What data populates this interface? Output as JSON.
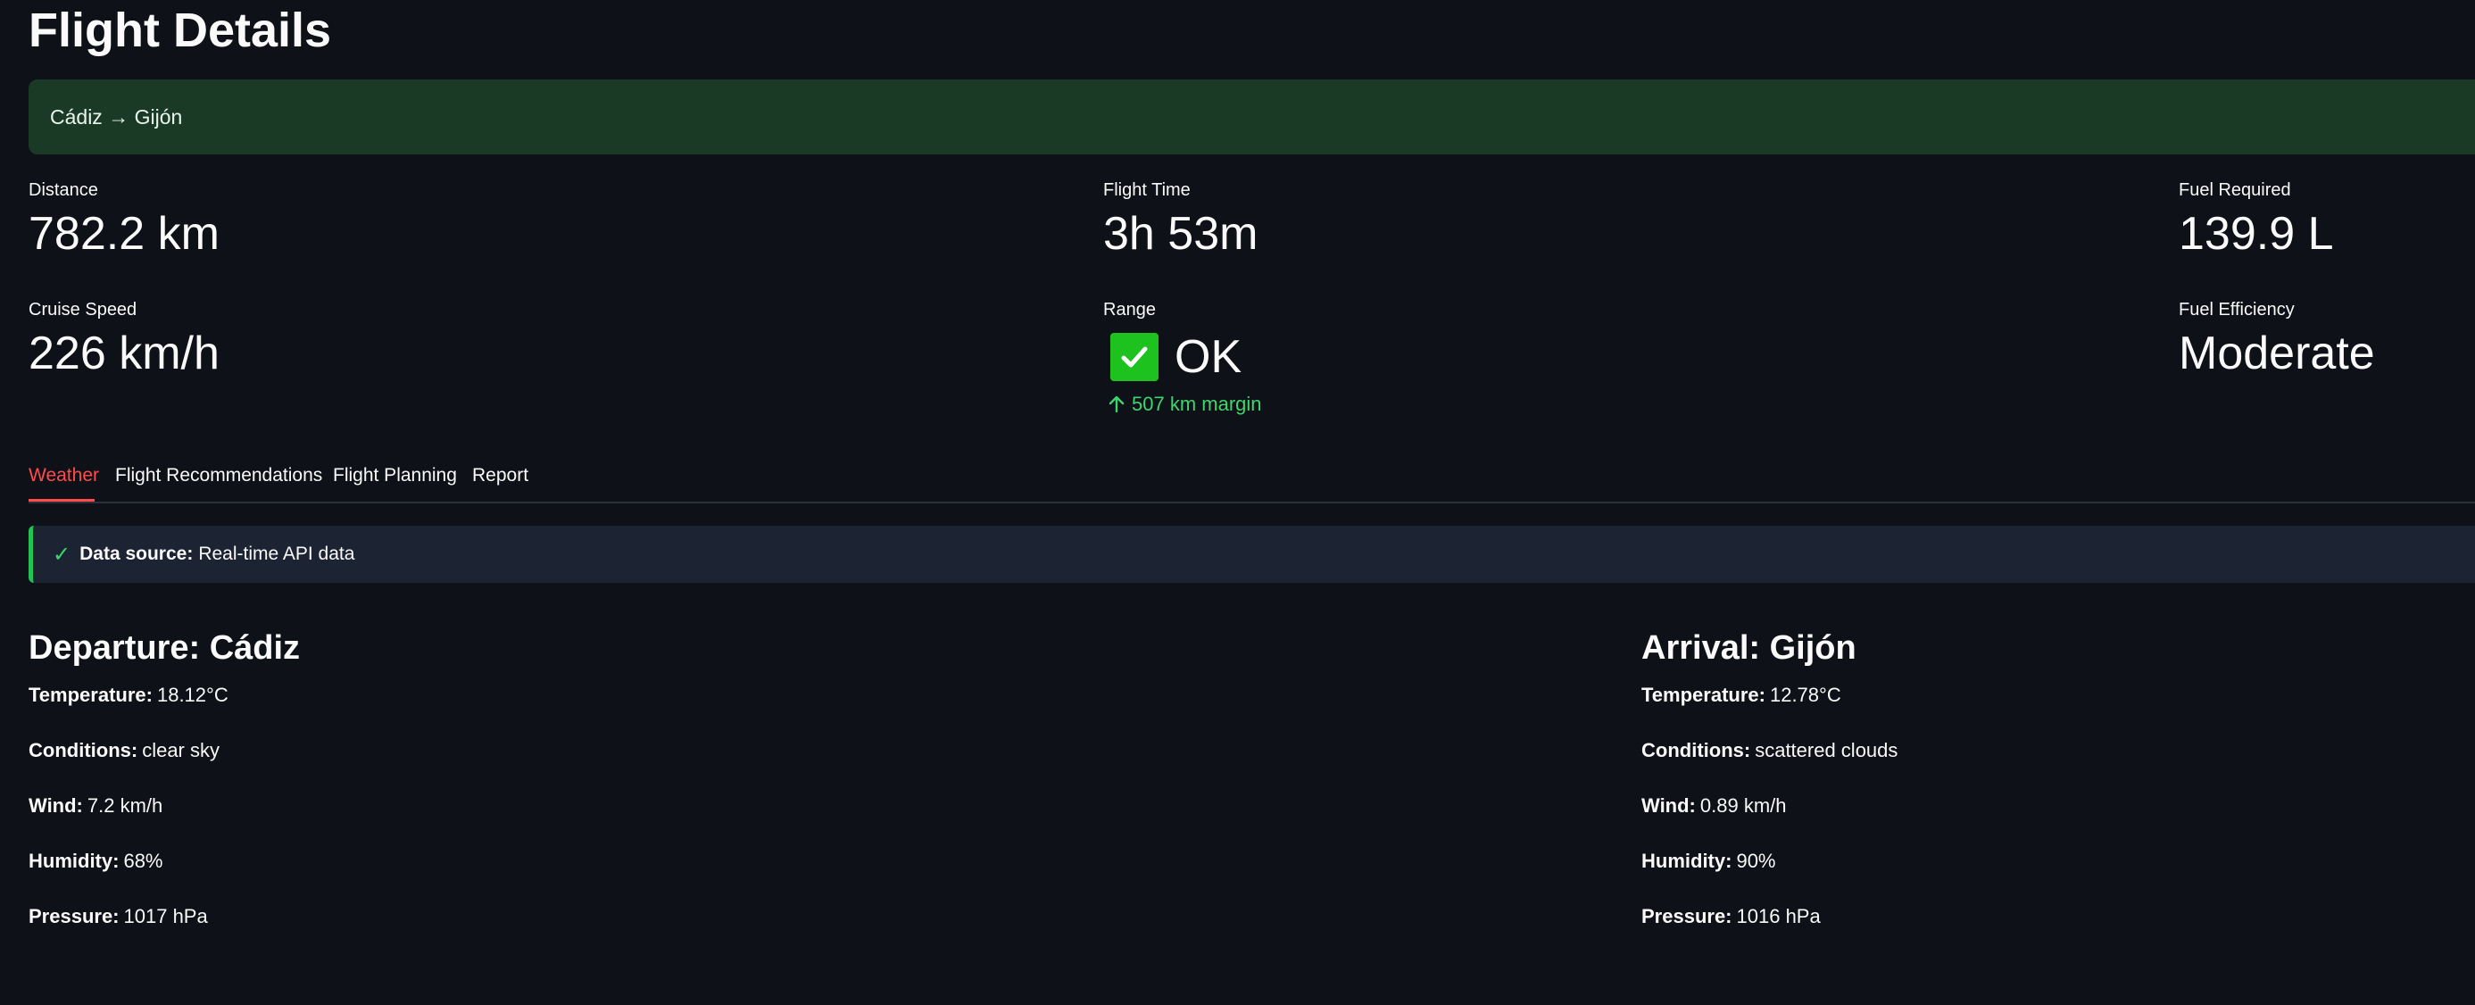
{
  "header": {
    "title": "Flight Details",
    "route": "Cádiz → Gijón"
  },
  "metrics": {
    "distance": {
      "label": "Distance",
      "value": "782.2 km"
    },
    "flight_time": {
      "label": "Flight Time",
      "value": "3h 53m"
    },
    "fuel_required": {
      "label": "Fuel Required",
      "value": "139.9 L"
    },
    "cruise_speed": {
      "label": "Cruise Speed",
      "value": "226 km/h"
    },
    "range": {
      "label": "Range",
      "value": "OK",
      "delta": "507 km margin",
      "icon": "check-mark-icon"
    },
    "fuel_efficiency": {
      "label": "Fuel Efficiency",
      "value": "Moderate"
    }
  },
  "tabs": [
    {
      "label": "Weather",
      "active": true
    },
    {
      "label": "Flight Recommendations",
      "active": false
    },
    {
      "label": "Flight Planning",
      "active": false
    },
    {
      "label": "Report",
      "active": false
    }
  ],
  "data_source": {
    "label": "Data source:",
    "value": "Real-time API data"
  },
  "departure": {
    "heading": "Departure: Cádiz",
    "temperature": {
      "label": "Temperature:",
      "value": "18.12°C"
    },
    "conditions": {
      "label": "Conditions:",
      "value": "clear sky"
    },
    "wind": {
      "label": "Wind:",
      "value": "7.2 km/h"
    },
    "humidity": {
      "label": "Humidity:",
      "value": "68%"
    },
    "pressure": {
      "label": "Pressure:",
      "value": "1017 hPa"
    }
  },
  "arrival": {
    "heading": "Arrival: Gijón",
    "temperature": {
      "label": "Temperature:",
      "value": "12.78°C"
    },
    "conditions": {
      "label": "Conditions:",
      "value": "scattered clouds"
    },
    "wind": {
      "label": "Wind:",
      "value": "0.89 km/h"
    },
    "humidity": {
      "label": "Humidity:",
      "value": "90%"
    },
    "pressure": {
      "label": "Pressure:",
      "value": "1016 hPa"
    }
  },
  "colors": {
    "background": "#0e1117",
    "banner": "#1b3a26",
    "accent_red": "#ff4b4b",
    "success_green": "#21c354",
    "check_green": "#1ec21e"
  }
}
